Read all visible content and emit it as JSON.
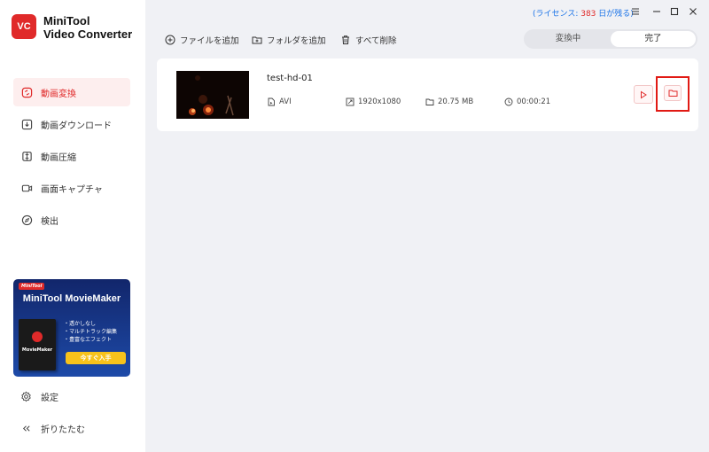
{
  "app": {
    "logo_text": "VC",
    "title_line1": "MiniTool",
    "title_line2": "Video Converter"
  },
  "sidebar": {
    "items": [
      {
        "label": "動画変換",
        "icon": "convert-icon",
        "active": true
      },
      {
        "label": "動画ダウンロード",
        "icon": "download-icon",
        "active": false
      },
      {
        "label": "動画圧縮",
        "icon": "compress-icon",
        "active": false
      },
      {
        "label": "画面キャプチャ",
        "icon": "camera-icon",
        "active": false
      },
      {
        "label": "検出",
        "icon": "compass-icon",
        "active": false
      }
    ],
    "settings_label": "設定",
    "collapse_label": "折りたたむ"
  },
  "promo": {
    "badge": "MiniTool",
    "title": "MiniTool MovieMaker",
    "box_label": "MovieMaker",
    "features": [
      "・透かしなし",
      "・マルチトラック編集",
      "・豊富なエフェクト"
    ],
    "cta": "今すぐ入手"
  },
  "license": {
    "prefix": "(ライセンス: ",
    "count": "383",
    "suffix": " 日が残る)"
  },
  "toolbar": {
    "add_files": "ファイルを追加",
    "add_folder": "フォルダを追加",
    "delete_all": "すべて削除"
  },
  "tabs": {
    "converting": "変換中",
    "finished": "完了"
  },
  "file": {
    "name": "test-hd-01",
    "format": "AVI",
    "resolution": "1920x1080",
    "size": "20.75 MB",
    "duration": "00:00:21"
  },
  "colors": {
    "accent": "#e02a2a",
    "license_link": "#1a73e8",
    "highlight_box": "#e11a14"
  }
}
